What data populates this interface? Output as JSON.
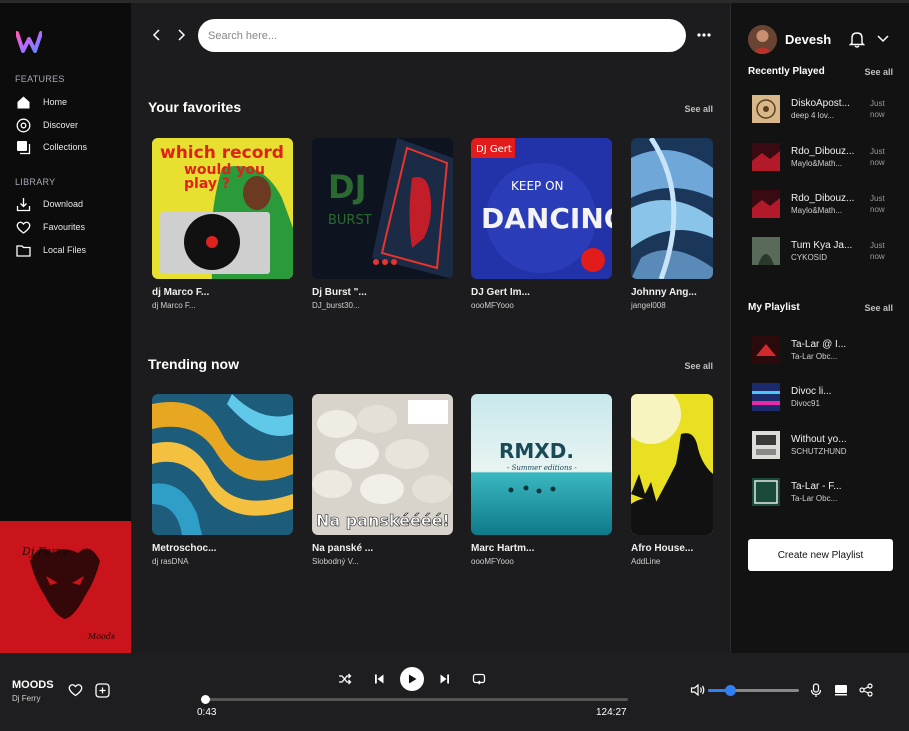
{
  "app": {
    "accent": "#2f7ff5"
  },
  "sidebar": {
    "features_label": "FEATURES",
    "library_label": "LIBRARY",
    "features": [
      {
        "label": "Home",
        "icon": "home-icon"
      },
      {
        "label": "Discover",
        "icon": "compass-icon"
      },
      {
        "label": "Collections",
        "icon": "collections-icon"
      }
    ],
    "library": [
      {
        "label": "Download",
        "icon": "download-icon"
      },
      {
        "label": "Favourites",
        "icon": "heart-icon"
      },
      {
        "label": "Local Files",
        "icon": "folder-icon"
      }
    ]
  },
  "search": {
    "placeholder": "Search here..."
  },
  "favorites": {
    "title": "Your favorites",
    "see_all": "See all",
    "cards": [
      {
        "title": "dj Marco F...",
        "subtitle": "dj Marco F..."
      },
      {
        "title": "Dj Burst \"...",
        "subtitle": "DJ_burst30..."
      },
      {
        "title": "DJ Gert Im...",
        "subtitle": "oooMFYooo"
      },
      {
        "title": "Johnny Ang...",
        "subtitle": "jangel008"
      }
    ]
  },
  "trending": {
    "title": "Trending now",
    "see_all": "See all",
    "cards": [
      {
        "title": "Metroschoc...",
        "subtitle": "dj rasDNA"
      },
      {
        "title": "Na panské ...",
        "subtitle": "Slobodný V..."
      },
      {
        "title": "Marc Hartm...",
        "subtitle": "oooMFYooo"
      },
      {
        "title": "Afro House...",
        "subtitle": "AddLine"
      }
    ]
  },
  "artwork_text": {
    "record_line1": "which record",
    "record_line2": "would you",
    "record_line3": "play ?",
    "dj": "DJ",
    "burst": "BURST",
    "gert_badge": "DJ Gert",
    "keep_on": "KEEP ON",
    "dancing": "DANCING",
    "panske": "Na panskéééé!",
    "rmxd": "RMXD.",
    "rmxd_sub": "- Summer editions -",
    "ferry_sig": "Dj Ferry",
    "moods_sig": "Moods"
  },
  "user": {
    "name": "Devesh"
  },
  "recently_played": {
    "title": "Recently Played",
    "see_all": "See all",
    "items": [
      {
        "title": "DiskoApost...",
        "artist": "deep 4 lov...",
        "time": "Just now"
      },
      {
        "title": "Rdo_Dibouz...",
        "artist": "Maylo&Math...",
        "time": "Just now"
      },
      {
        "title": "Rdo_Dibouz...",
        "artist": "Maylo&Math...",
        "time": "Just now"
      },
      {
        "title": "Tum Kya Ja...",
        "artist": "CYKOSID",
        "time": "Just now"
      }
    ]
  },
  "my_playlist": {
    "title": "My Playlist",
    "see_all": "See all",
    "items": [
      {
        "title": "Ta-Lar @ I...",
        "artist": "Ta-Lar Obc..."
      },
      {
        "title": "Divoc li...",
        "artist": "Divoc91"
      },
      {
        "title": "Without yo...",
        "artist": "SCHUTZHUND"
      },
      {
        "title": "Ta-Lar - F...",
        "artist": "Ta-Lar Obc..."
      }
    ],
    "create_label": "Create new Playlist"
  },
  "player": {
    "song": "MOODS",
    "artist": "Dj Ferry",
    "current_time": "0:43",
    "total_time": "124:27",
    "progress": 0.006,
    "volume": 0.25
  }
}
